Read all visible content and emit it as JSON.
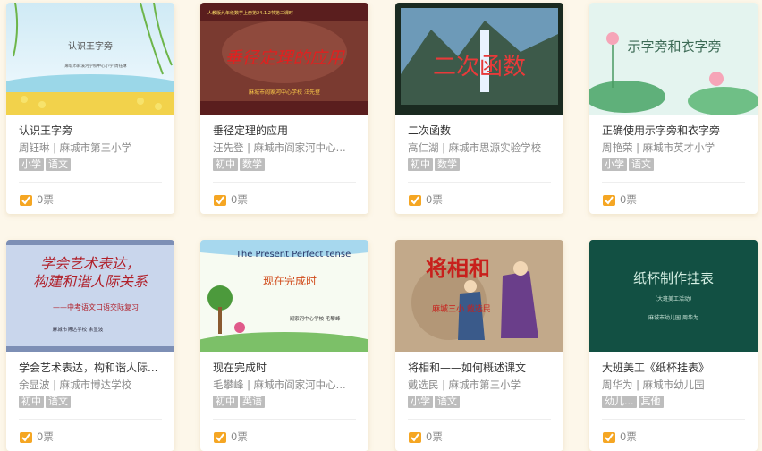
{
  "cards": [
    {
      "title": "认识王字旁",
      "meta": "周钰琳 | 麻城市第三小学",
      "tags": [
        "小学",
        "语文"
      ],
      "votes": "0票",
      "thumb_title": "认识王字旁",
      "thumb_sub": "麻城市麻溪河学校中心小学   周钰琳"
    },
    {
      "title": "垂径定理的应用",
      "meta": "汪先登 | 麻城市阎家河中心...",
      "tags": [
        "初中",
        "数学"
      ],
      "votes": "0票",
      "thumb_title": "垂径定理的应用",
      "thumb_sub": "麻城市阎家河中心学校   汪先登",
      "thumb_top": "人教版九年级数学上册第24.1.2节第二课时"
    },
    {
      "title": "二次函数",
      "meta": "高仁湖 | 麻城市思源实验学校",
      "tags": [
        "初中",
        "数学"
      ],
      "votes": "0票",
      "thumb_title": "二次函数"
    },
    {
      "title": "正确使用示字旁和衣字旁",
      "meta": "周艳荣 | 麻城市英才小学",
      "tags": [
        "小学",
        "语文"
      ],
      "votes": "0票",
      "thumb_title": "示字旁和衣字旁"
    },
    {
      "title": "学会艺术表达，构和谐人际...",
      "meta": "余显波 | 麻城市博达学校",
      "tags": [
        "初中",
        "语文"
      ],
      "votes": "0票",
      "thumb_title1": "学会艺术表达，",
      "thumb_title2": "构建和谐人际关系",
      "thumb_sub": "——中考语文口语交际复习",
      "thumb_sub2": "麻城市博达学校   余显波"
    },
    {
      "title": "现在完成时",
      "meta": "毛攀峰 | 麻城市阎家河中心...",
      "tags": [
        "初中",
        "英语"
      ],
      "votes": "0票",
      "thumb_en": "The Present Perfect tense",
      "thumb_title": "现在完成时",
      "thumb_sub": "阎家河中心学校  毛攀峰"
    },
    {
      "title": "将相和——如何概述课文",
      "meta": "戴选民 | 麻城市第三小学",
      "tags": [
        "小学",
        "语文"
      ],
      "votes": "0票",
      "thumb_title": "将相和",
      "thumb_sub": "麻城三小  戴选民"
    },
    {
      "title": "大班美工《纸杯挂表》",
      "meta": "周华为 | 麻城市幼儿园",
      "tags": [
        "幼儿...",
        "其他"
      ],
      "votes": "0票",
      "thumb_title": "纸杯制作挂表",
      "thumb_sub": "（大班美工活动）",
      "thumb_sub2": "麻城市幼儿园   周华为"
    }
  ],
  "colors": {
    "page_bg": "#fdf7ea",
    "tag_bg": "#bdbdbd",
    "vote_icon": "#f5a623"
  }
}
